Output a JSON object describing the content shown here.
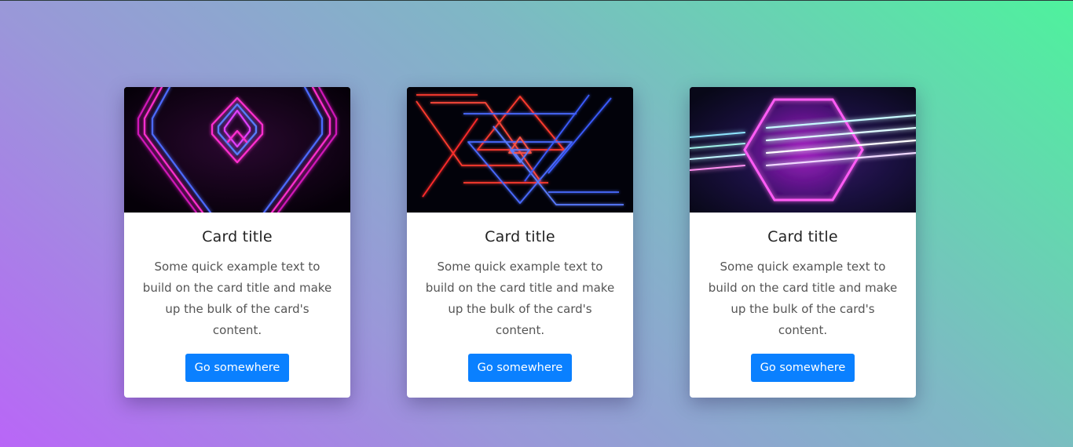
{
  "cards": [
    {
      "image_icon": "neon-chevrons-image",
      "title": "Card title",
      "text": "Some quick example text to build on the card title and make up the bulk of the card's content.",
      "button_label": "Go somewhere"
    },
    {
      "image_icon": "neon-triangles-image",
      "title": "Card title",
      "text": "Some quick example text to build on the card title and make up the bulk of the card's content.",
      "button_label": "Go somewhere"
    },
    {
      "image_icon": "neon-hexagon-image",
      "title": "Card title",
      "text": "Some quick example text to build on the card title and make up the bulk of the card's content.",
      "button_label": "Go somewhere"
    }
  ],
  "colors": {
    "background_start": "#4ef29d",
    "background_end": "#b966f7",
    "button": "#0a80ff",
    "card": "#ffffff"
  }
}
